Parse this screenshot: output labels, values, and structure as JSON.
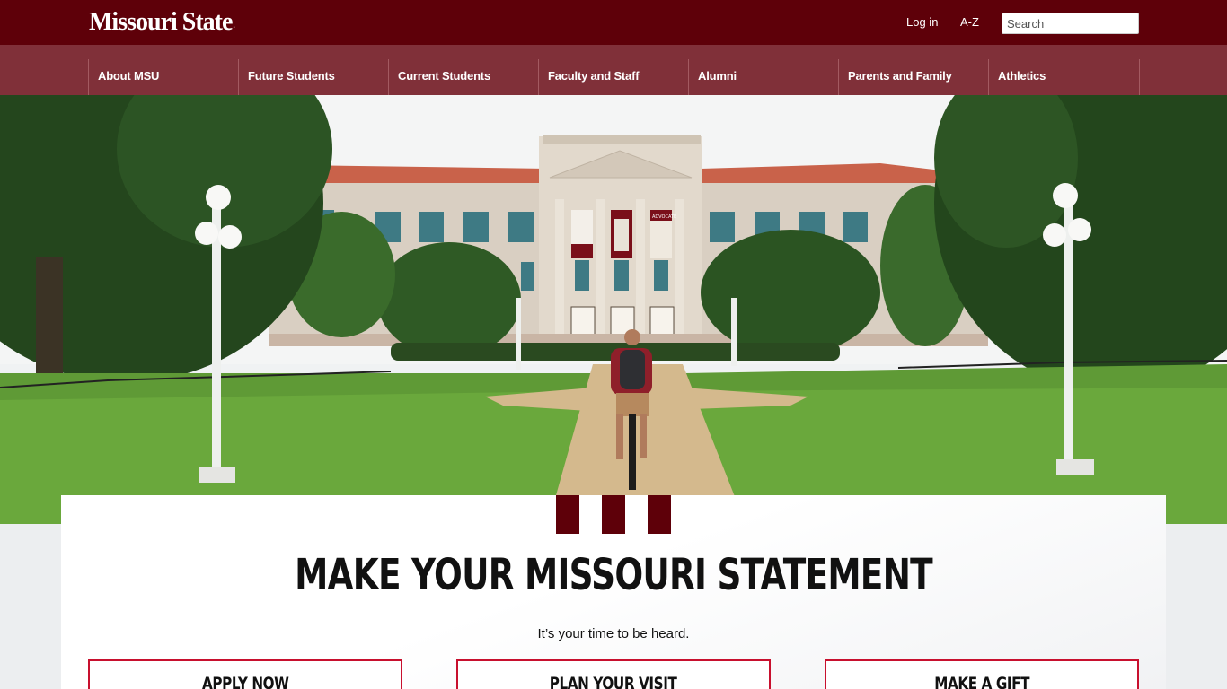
{
  "header": {
    "logo_text": "Missouri State",
    "logo_mark": ".",
    "login_label": "Log in",
    "az_label": "A-Z",
    "search_placeholder": "Search"
  },
  "nav": {
    "items": [
      {
        "label": "About MSU"
      },
      {
        "label": "Future Students"
      },
      {
        "label": "Current Students"
      },
      {
        "label": "Faculty and Staff"
      },
      {
        "label": "Alumni"
      },
      {
        "label": "Parents and Family"
      },
      {
        "label": "Athletics"
      }
    ]
  },
  "hero": {
    "banner_text": "ADVOCATE"
  },
  "main": {
    "headline": "MAKE YOUR MISSOURI STATEMENT",
    "tagline": "It’s your time to be heard.",
    "ctas": [
      {
        "label": "APPLY NOW"
      },
      {
        "label": "PLAN YOUR VISIT"
      },
      {
        "label": "MAKE A GIFT"
      }
    ]
  },
  "colors": {
    "brand_maroon": "#5e0009",
    "nav_maroon": "#803039",
    "cta_border": "#c8102e"
  }
}
